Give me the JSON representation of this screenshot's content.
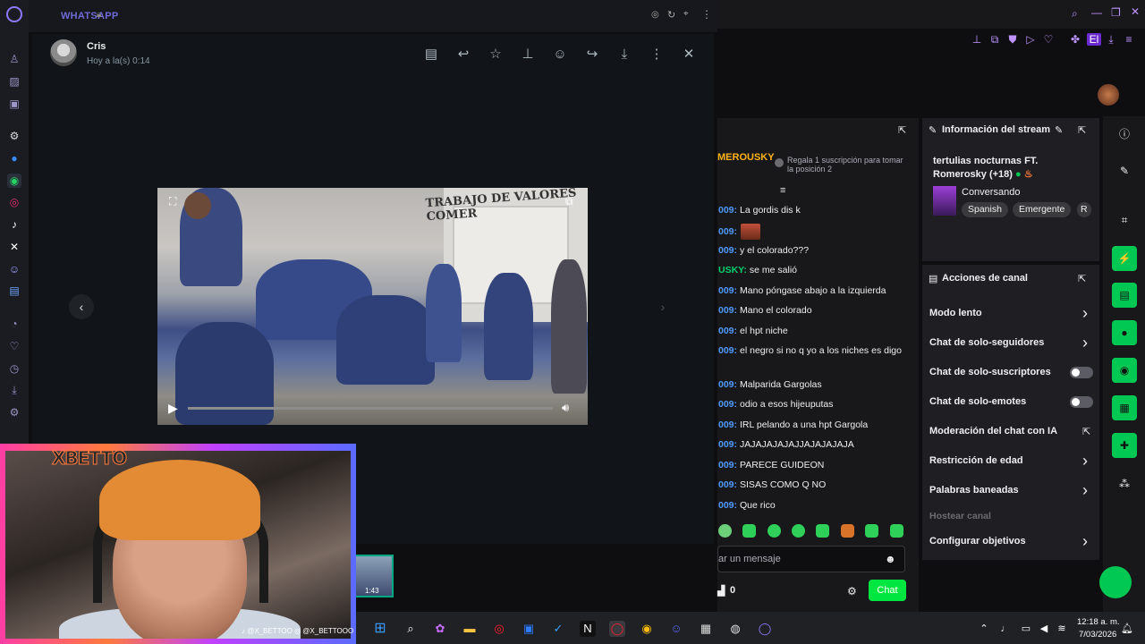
{
  "whatsapp": {
    "window_title": "WHATSAPP",
    "sender": "Cris",
    "timestamp": "Hoy a la(s) 0:14",
    "video": {
      "progress_fraction": 0.0,
      "wall_writing": "TRABAJO DE VALORES COMER"
    },
    "thumbnail_duration": "1:43"
  },
  "webcam": {
    "logo_text": "XBETTO",
    "handles": "♪ @X_BETTOO  ◎ @X_BETTOOO"
  },
  "twitch": {
    "pinned_user": "MEROUSKY",
    "pinned_text": "Regala 1 suscripción para tomar la posición 2",
    "chat": [
      {
        "user": "009:",
        "msg": "La gordis dis k",
        "color": "blue"
      },
      {
        "user": "009:",
        "msg": "",
        "color": "blue",
        "emote": true
      },
      {
        "user": "009:",
        "msg": "y el colorado???",
        "color": "blue"
      },
      {
        "user": "USKY:",
        "msg": "se me salió",
        "color": "green"
      },
      {
        "user": "009:",
        "msg": "Mano póngase abajo a la izquierda",
        "color": "blue"
      },
      {
        "user": "009:",
        "msg": "Mano el colorado",
        "color": "blue"
      },
      {
        "user": "009:",
        "msg": "el hpt niche",
        "color": "blue"
      },
      {
        "user": "009:",
        "msg": "el negro si no q yo a los niches es digo",
        "color": "blue"
      },
      {
        "user": "009:",
        "msg": "Malparida Gargolas",
        "color": "blue"
      },
      {
        "user": "009:",
        "msg": "odio a esos hijeuputas",
        "color": "blue"
      },
      {
        "user": "009:",
        "msg": "IRL pelando a una hpt Gargola",
        "color": "blue"
      },
      {
        "user": "009:",
        "msg": "JAJAJAJAJAJJAJAJAJAJA",
        "color": "blue"
      },
      {
        "user": "009:",
        "msg": "PARECE GUIDEON",
        "color": "blue"
      },
      {
        "user": "009:",
        "msg": "SISAS COMO Q NO",
        "color": "blue"
      },
      {
        "user": "009:",
        "msg": "Que rico",
        "color": "blue"
      }
    ],
    "chat_input_placeholder": "ar un mensaje",
    "points": "0",
    "chat_button": "Chat",
    "stream_info": {
      "header": "Información del stream",
      "title": "tertulias nocturnas FT. Romerosky (+18)",
      "category": "Conversando",
      "tags": [
        "Spanish",
        "Emergente",
        "R"
      ]
    },
    "channel_actions": {
      "header": "Acciones de canal",
      "items": [
        {
          "label": "Modo lento",
          "control": "chevron"
        },
        {
          "label": "Chat de solo-seguidores",
          "control": "chevron"
        },
        {
          "label": "Chat de solo-suscriptores",
          "control": "toggle"
        },
        {
          "label": "Chat de solo-emotes",
          "control": "toggle"
        },
        {
          "label": "Moderación del chat con IA",
          "control": "external"
        },
        {
          "label": "Restricción de edad",
          "control": "chevron"
        },
        {
          "label": "Palabras baneadas",
          "control": "chevron"
        },
        {
          "label": "Hostear canal",
          "control": "none",
          "disabled": true
        },
        {
          "label": "Configurar objetivos",
          "control": "chevron"
        }
      ]
    }
  },
  "taskbar": {
    "time": "12:18 a. m.",
    "date": "7/03/2026"
  }
}
